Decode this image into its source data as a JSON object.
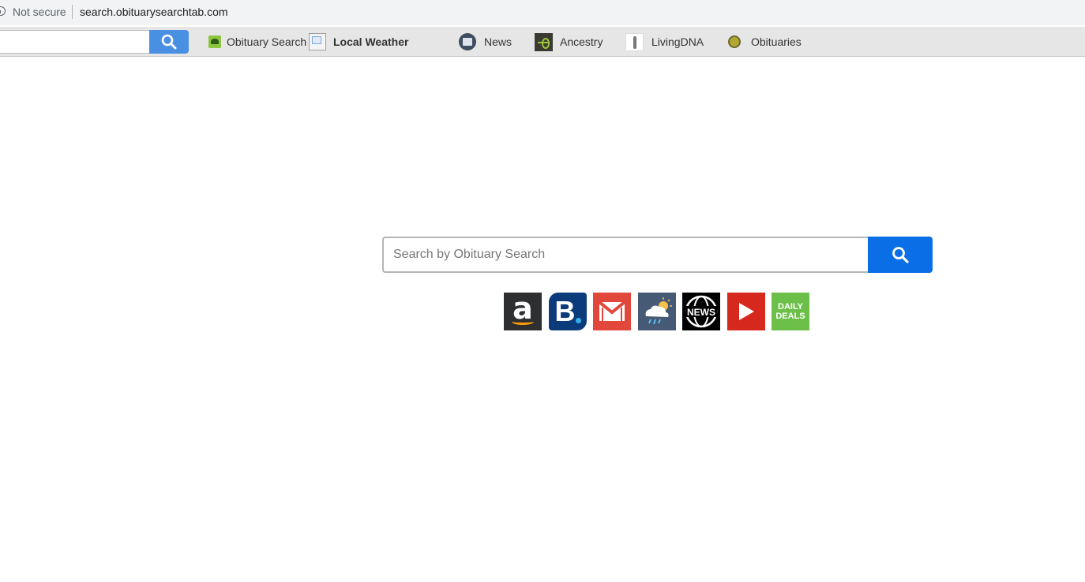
{
  "browser": {
    "security_label": "Not secure",
    "url": "search.obituarysearchtab.com"
  },
  "toolbar": {
    "links": [
      {
        "label": "Obituary Search",
        "icon": "obituary-search-logo-icon"
      },
      {
        "label": "Local Weather",
        "icon": "broken-image-icon"
      },
      {
        "label": "News",
        "icon": "news-icon"
      },
      {
        "label": "Ancestry",
        "icon": "ancestry-icon"
      },
      {
        "label": "LivingDNA",
        "icon": "livingdna-icon"
      },
      {
        "label": "Obituaries",
        "icon": "obituaries-icon"
      }
    ],
    "search_value": ""
  },
  "main": {
    "search_placeholder": "Search by Obituary Search",
    "search_value": ""
  },
  "quick_links": [
    {
      "name": "amazon",
      "label": "a"
    },
    {
      "name": "booking",
      "label": "B"
    },
    {
      "name": "gmail",
      "label": ""
    },
    {
      "name": "weather",
      "label": ""
    },
    {
      "name": "news",
      "label": "NEWS"
    },
    {
      "name": "youtube",
      "label": ""
    },
    {
      "name": "daily-deals",
      "label_line1": "DAILY",
      "label_line2": "DEALS"
    }
  ],
  "colors": {
    "accent_blue": "#0a6fe6",
    "toolbar_blue": "#4a90e2",
    "toolbar_bg": "#e6e6e6"
  }
}
